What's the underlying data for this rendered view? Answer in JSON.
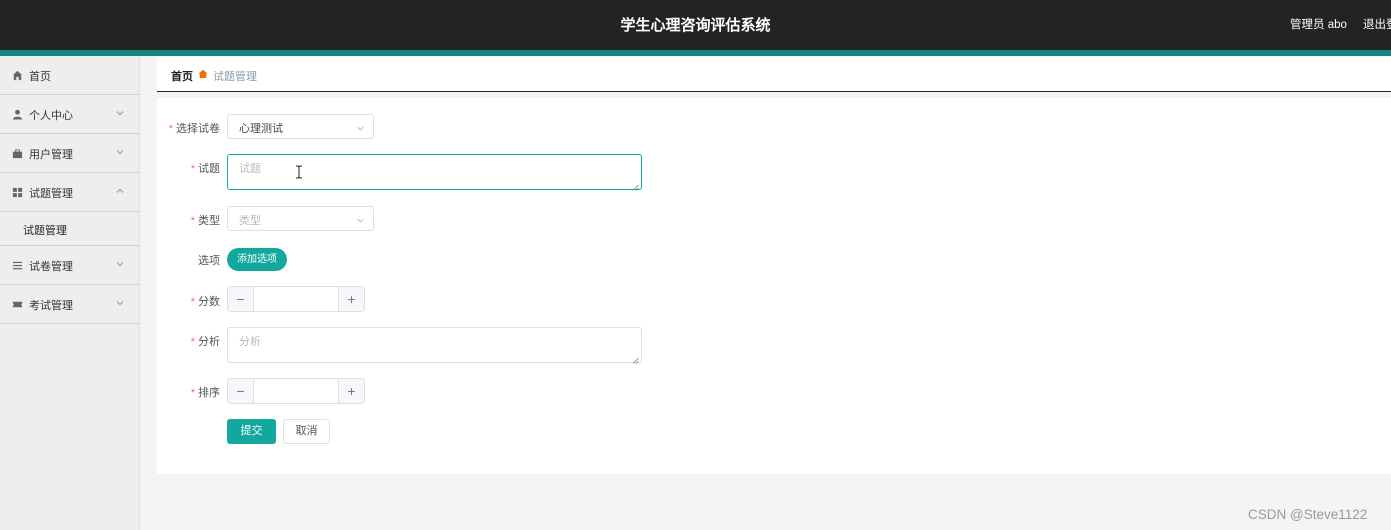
{
  "header": {
    "title": "学生心理咨询评估系统",
    "user": "管理员 abo",
    "logout": "退出登录"
  },
  "sidebar": {
    "items": [
      {
        "label": "首页",
        "icon": "home-icon"
      },
      {
        "label": "个人中心",
        "icon": "user-icon"
      },
      {
        "label": "用户管理",
        "icon": "briefcase-icon"
      },
      {
        "label": "试题管理",
        "icon": "grid-icon",
        "expanded": true
      },
      {
        "label": "试卷管理",
        "icon": "list-icon"
      },
      {
        "label": "考试管理",
        "icon": "ticket-icon"
      }
    ],
    "sub_items": [
      {
        "label": "试题管理"
      }
    ]
  },
  "breadcrumb": {
    "home": "首页",
    "current": "试题管理",
    "separator_color": "#f56a00"
  },
  "form": {
    "paper": {
      "label": "选择试卷",
      "value": "心理测试"
    },
    "question": {
      "label": "试题",
      "placeholder": "试题"
    },
    "type": {
      "label": "类型",
      "placeholder": "类型"
    },
    "options": {
      "label": "选项",
      "button": "添加选项"
    },
    "score": {
      "label": "分数",
      "value": "",
      "minus": "−",
      "plus": "+"
    },
    "analysis": {
      "label": "分析",
      "placeholder": "分析"
    },
    "order": {
      "label": "排序",
      "value": "",
      "minus": "−",
      "plus": "+"
    },
    "submit": "提交",
    "cancel": "取消"
  },
  "colors": {
    "accent": "#13a89e",
    "header_bg": "#232323",
    "required": "#f56c6c"
  },
  "watermark": "CSDN @Steve1122"
}
